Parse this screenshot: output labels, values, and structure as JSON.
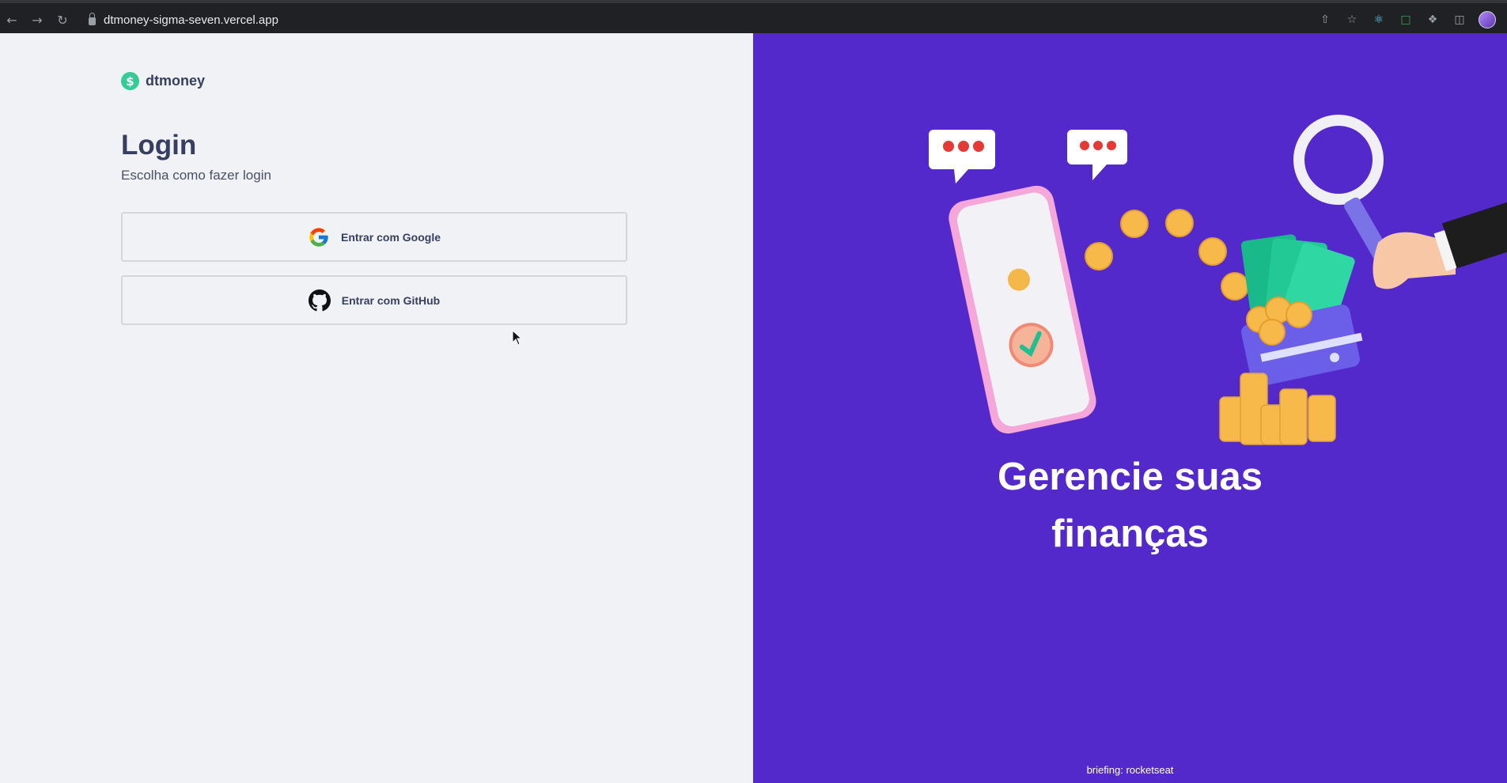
{
  "browser": {
    "url": "dtmoney-sigma-seven.vercel.app",
    "nav_icons": [
      "back-icon",
      "forward-icon",
      "reload-icon"
    ],
    "right_icons": [
      "share-icon",
      "star-icon",
      "react-devtools-icon",
      "screenshot-icon",
      "extensions-icon",
      "sidepanel-icon",
      "profile-avatar"
    ]
  },
  "brand": {
    "name": "dtmoney",
    "icon": "dollar-icon",
    "accent": "#33cc95"
  },
  "login": {
    "title": "Login",
    "subtitle": "Escolha como fazer login",
    "google_label": "Entrar com Google",
    "github_label": "Entrar com GitHub"
  },
  "hero": {
    "headline_line1": "Gerencie suas",
    "headline_line2": "finanças",
    "credit_line1": "briefing: rocketseat",
    "background": "#5429cc"
  }
}
